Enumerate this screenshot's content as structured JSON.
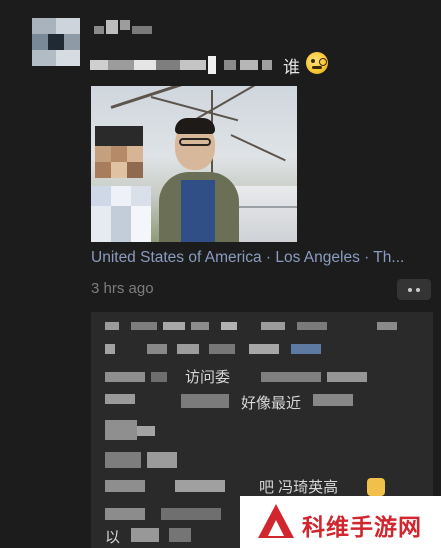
{
  "post": {
    "text_visible": "谁",
    "emoji_icon": "face-with-monocle-icon",
    "location": "United States of America · Los Angeles · Th...",
    "timestamp": "3 hrs ago",
    "more_icon": "more-options-icon"
  },
  "comments": {
    "fragment1": "访问委",
    "fragment2": "好像最近",
    "fragment3": "吧 冯琦英高",
    "fragment4": "以"
  },
  "watermark": {
    "text": "科维手游网"
  },
  "colors": {
    "background": "#1c1c1c",
    "comments_bg": "#2a2a2a",
    "link": "#8b9cc0",
    "timestamp": "#7d7d7d",
    "watermark_red": "#d1262e"
  }
}
